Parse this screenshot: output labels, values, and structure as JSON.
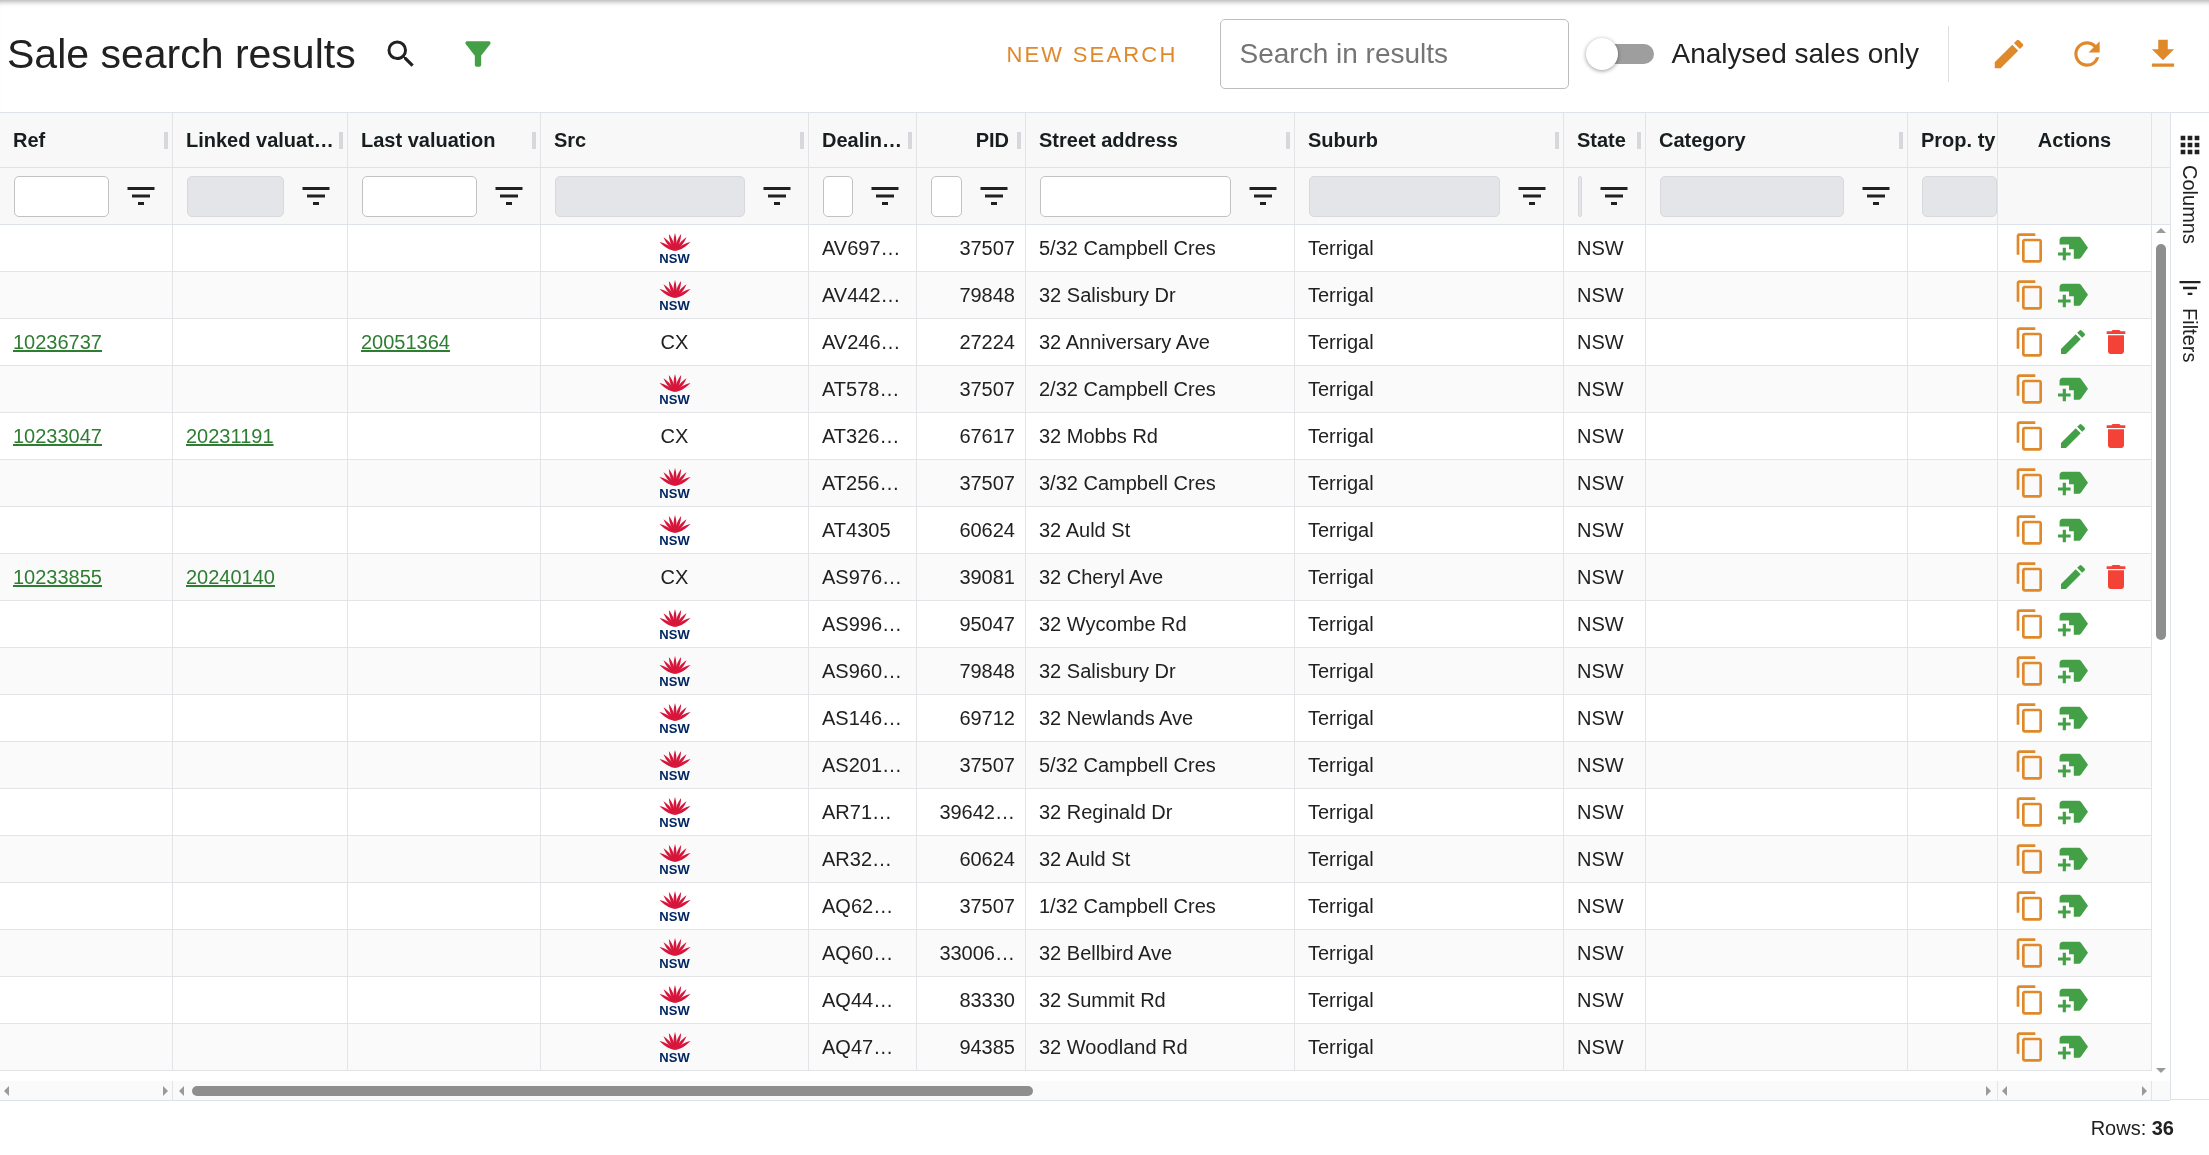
{
  "toolbar": {
    "title": "Sale search results",
    "new_search": "NEW SEARCH",
    "search": {
      "placeholder": "Search in results"
    },
    "analysed_only": {
      "label": "Analysed sales only",
      "on": false
    }
  },
  "table": {
    "columns": [
      {
        "label": "Ref",
        "filter_disabled": false
      },
      {
        "label": "Linked valuat…",
        "filter_disabled": true
      },
      {
        "label": "Last valuation",
        "filter_disabled": false
      },
      {
        "label": "Src",
        "filter_disabled": true
      },
      {
        "label": "Dealin…",
        "filter_disabled": false
      },
      {
        "label": "PID",
        "filter_disabled": false
      },
      {
        "label": "Street address",
        "filter_disabled": false
      },
      {
        "label": "Suburb",
        "filter_disabled": true
      },
      {
        "label": "State",
        "filter_disabled": true
      },
      {
        "label": "Category",
        "filter_disabled": true
      },
      {
        "label": "Prop. ty",
        "filter_disabled": true
      }
    ],
    "actions_column": {
      "label": "Actions"
    },
    "rows": [
      {
        "src": {
          "kind": "logo",
          "text": "NSW"
        },
        "column_5": "AV697…",
        "pid": "37507",
        "street_address": "5/32 Campbell Cres",
        "suburb": "Terrigal",
        "state": "NSW",
        "actions": [
          {
            "kind": "copy"
          },
          {
            "kind": "add_tag"
          }
        ]
      },
      {
        "src": {
          "kind": "logo",
          "text": "NSW"
        },
        "column_5": "AV442…",
        "pid": "79848",
        "street_address": "32 Salisbury Dr",
        "suburb": "Terrigal",
        "state": "NSW",
        "actions": [
          {
            "kind": "copy"
          },
          {
            "kind": "add_tag"
          }
        ]
      },
      {
        "ref": "10236737",
        "last_valuation": "20051364",
        "src": {
          "kind": "text",
          "text": "CX"
        },
        "column_5": "AV246…",
        "pid": "27224",
        "street_address": "32 Anniversary Ave",
        "suburb": "Terrigal",
        "state": "NSW",
        "actions": [
          {
            "kind": "copy"
          },
          {
            "kind": "edit"
          },
          {
            "kind": "delete"
          }
        ]
      },
      {
        "src": {
          "kind": "logo",
          "text": "NSW"
        },
        "column_5": "AT578…",
        "pid": "37507",
        "street_address": "2/32 Campbell Cres",
        "suburb": "Terrigal",
        "state": "NSW",
        "actions": [
          {
            "kind": "copy"
          },
          {
            "kind": "add_tag"
          }
        ]
      },
      {
        "ref": "10233047",
        "column_2": "20231191",
        "src": {
          "kind": "text",
          "text": "CX"
        },
        "column_5": "AT326…",
        "pid": "67617",
        "street_address": "32 Mobbs Rd",
        "suburb": "Terrigal",
        "state": "NSW",
        "actions": [
          {
            "kind": "copy"
          },
          {
            "kind": "edit"
          },
          {
            "kind": "delete"
          }
        ]
      },
      {
        "src": {
          "kind": "logo",
          "text": "NSW"
        },
        "column_5": "AT256…",
        "pid": "37507",
        "street_address": "3/32 Campbell Cres",
        "suburb": "Terrigal",
        "state": "NSW",
        "actions": [
          {
            "kind": "copy"
          },
          {
            "kind": "add_tag"
          }
        ]
      },
      {
        "src": {
          "kind": "logo",
          "text": "NSW"
        },
        "column_5": "AT4305",
        "pid": "60624",
        "street_address": "32 Auld St",
        "suburb": "Terrigal",
        "state": "NSW",
        "actions": [
          {
            "kind": "copy"
          },
          {
            "kind": "add_tag"
          }
        ]
      },
      {
        "ref": "10233855",
        "column_2": "20240140",
        "src": {
          "kind": "text",
          "text": "CX"
        },
        "column_5": "AS976…",
        "pid": "39081",
        "street_address": "32 Cheryl Ave",
        "suburb": "Terrigal",
        "state": "NSW",
        "actions": [
          {
            "kind": "copy"
          },
          {
            "kind": "edit"
          },
          {
            "kind": "delete"
          }
        ]
      },
      {
        "src": {
          "kind": "logo",
          "text": "NSW"
        },
        "column_5": "AS996…",
        "pid": "95047",
        "street_address": "32 Wycombe Rd",
        "suburb": "Terrigal",
        "state": "NSW",
        "actions": [
          {
            "kind": "copy"
          },
          {
            "kind": "add_tag"
          }
        ]
      },
      {
        "src": {
          "kind": "logo",
          "text": "NSW"
        },
        "column_5": "AS960…",
        "pid": "79848",
        "street_address": "32 Salisbury Dr",
        "suburb": "Terrigal",
        "state": "NSW",
        "actions": [
          {
            "kind": "copy"
          },
          {
            "kind": "add_tag"
          }
        ]
      },
      {
        "src": {
          "kind": "logo",
          "text": "NSW"
        },
        "column_5": "AS146…",
        "pid": "69712",
        "street_address": "32 Newlands Ave",
        "suburb": "Terrigal",
        "state": "NSW",
        "actions": [
          {
            "kind": "copy"
          },
          {
            "kind": "add_tag"
          }
        ]
      },
      {
        "src": {
          "kind": "logo",
          "text": "NSW"
        },
        "column_5": "AS201…",
        "pid": "37507",
        "street_address": "5/32 Campbell Cres",
        "suburb": "Terrigal",
        "state": "NSW",
        "actions": [
          {
            "kind": "copy"
          },
          {
            "kind": "add_tag"
          }
        ]
      },
      {
        "src": {
          "kind": "logo",
          "text": "NSW"
        },
        "column_5": "AR71…",
        "pid": "39642…",
        "street_address": "32 Reginald Dr",
        "suburb": "Terrigal",
        "state": "NSW",
        "actions": [
          {
            "kind": "copy"
          },
          {
            "kind": "add_tag"
          }
        ]
      },
      {
        "src": {
          "kind": "logo",
          "text": "NSW"
        },
        "column_5": "AR32…",
        "pid": "60624",
        "street_address": "32 Auld St",
        "suburb": "Terrigal",
        "state": "NSW",
        "actions": [
          {
            "kind": "copy"
          },
          {
            "kind": "add_tag"
          }
        ]
      },
      {
        "src": {
          "kind": "logo",
          "text": "NSW"
        },
        "column_5": "AQ62…",
        "pid": "37507",
        "street_address": "1/32 Campbell Cres",
        "suburb": "Terrigal",
        "state": "NSW",
        "actions": [
          {
            "kind": "copy"
          },
          {
            "kind": "add_tag"
          }
        ]
      },
      {
        "src": {
          "kind": "logo",
          "text": "NSW"
        },
        "column_5": "AQ60…",
        "pid": "33006…",
        "street_address": "32 Bellbird Ave",
        "suburb": "Terrigal",
        "state": "NSW",
        "actions": [
          {
            "kind": "copy"
          },
          {
            "kind": "add_tag"
          }
        ]
      },
      {
        "src": {
          "kind": "logo",
          "text": "NSW"
        },
        "column_5": "AQ44…",
        "pid": "83330",
        "street_address": "32 Summit Rd",
        "suburb": "Terrigal",
        "state": "NSW",
        "actions": [
          {
            "kind": "copy"
          },
          {
            "kind": "add_tag"
          }
        ]
      },
      {
        "src": {
          "kind": "logo",
          "text": "NSW"
        },
        "column_5": "AQ47…",
        "pid": "94385",
        "street_address": "32 Woodland Rd",
        "suburb": "Terrigal",
        "state": "NSW",
        "actions": [
          {
            "kind": "copy"
          },
          {
            "kind": "add_tag"
          }
        ]
      }
    ]
  },
  "side_panel": {
    "tabs": [
      {
        "kind": "columns",
        "label": "Columns"
      },
      {
        "kind": "filters",
        "label": "Filters"
      }
    ]
  },
  "footer": {
    "row_count": "Rows: **36**"
  }
}
